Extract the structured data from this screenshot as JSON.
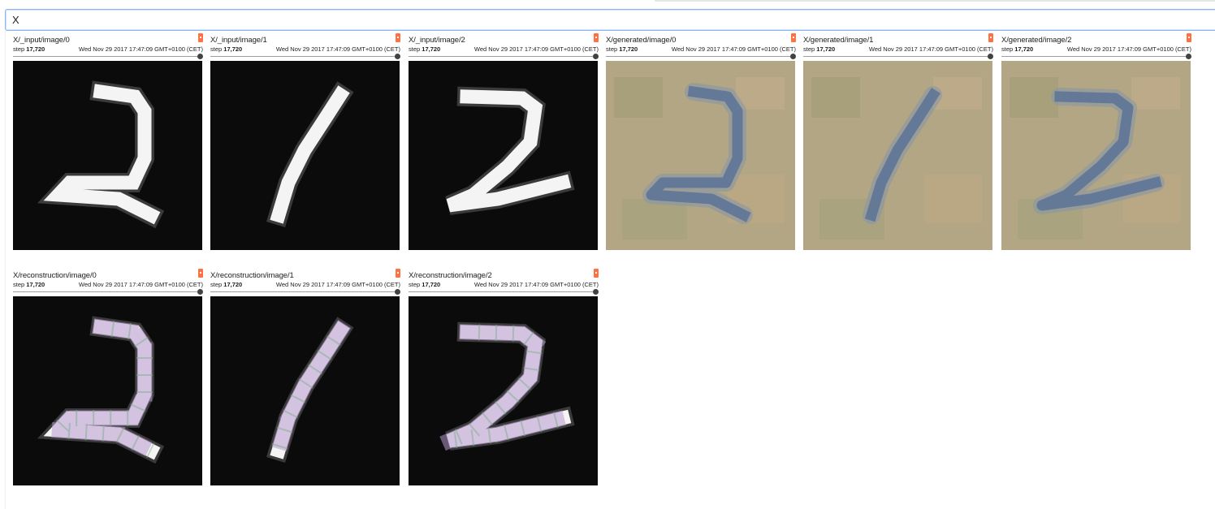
{
  "search": {
    "value": "X"
  },
  "cards": [
    {
      "title": "X/_input/image/0",
      "step_label": "step",
      "step": "17,720",
      "wall_time": "Wed Nov 29 2017 17:47:09 GMT+0100 (CET)",
      "image_icon": "digit-2-grayscale-image",
      "kind": "input",
      "digit": "2a"
    },
    {
      "title": "X/_input/image/1",
      "step_label": "step",
      "step": "17,720",
      "wall_time": "Wed Nov 29 2017 17:47:09 GMT+0100 (CET)",
      "image_icon": "digit-1-grayscale-image",
      "kind": "input",
      "digit": "1"
    },
    {
      "title": "X/_input/image/2",
      "step_label": "step",
      "step": "17,720",
      "wall_time": "Wed Nov 29 2017 17:47:09 GMT+0100 (CET)",
      "image_icon": "digit-2-grayscale-image",
      "kind": "input",
      "digit": "2b"
    },
    {
      "title": "X/generated/image/0",
      "step_label": "step",
      "step": "17,720",
      "wall_time": "Wed Nov 29 2017 17:47:09 GMT+0100 (CET)",
      "image_icon": "generated-digit-2-image",
      "kind": "generated",
      "digit": "2a"
    },
    {
      "title": "X/generated/image/1",
      "step_label": "step",
      "step": "17,720",
      "wall_time": "Wed Nov 29 2017 17:47:09 GMT+0100 (CET)",
      "image_icon": "generated-digit-1-image",
      "kind": "generated",
      "digit": "1"
    },
    {
      "title": "X/generated/image/2",
      "step_label": "step",
      "step": "17,720",
      "wall_time": "Wed Nov 29 2017 17:47:09 GMT+0100 (CET)",
      "image_icon": "generated-digit-2-image",
      "kind": "generated",
      "digit": "2b"
    },
    {
      "title": "X/reconstruction/image/0",
      "step_label": "step",
      "step": "17,720",
      "wall_time": "Wed Nov 29 2017 17:47:09 GMT+0100 (CET)",
      "image_icon": "reconstructed-digit-2-image",
      "kind": "reconstruction",
      "digit": "2a"
    },
    {
      "title": "X/reconstruction/image/1",
      "step_label": "step",
      "step": "17,720",
      "wall_time": "Wed Nov 29 2017 17:47:09 GMT+0100 (CET)",
      "image_icon": "reconstructed-digit-1-image",
      "kind": "reconstruction",
      "digit": "1"
    },
    {
      "title": "X/reconstruction/image/2",
      "step_label": "step",
      "step": "17,720",
      "wall_time": "Wed Nov 29 2017 17:47:09 GMT+0100 (CET)",
      "image_icon": "reconstructed-digit-2-image",
      "kind": "reconstruction",
      "digit": "2b"
    }
  ],
  "colors": {
    "accent": "#8ab4f8",
    "flag": "#ff7043",
    "input_bg": "#0b0b0b",
    "generated_bg": "#a8a07e",
    "generated_stroke": "#5a7396"
  }
}
